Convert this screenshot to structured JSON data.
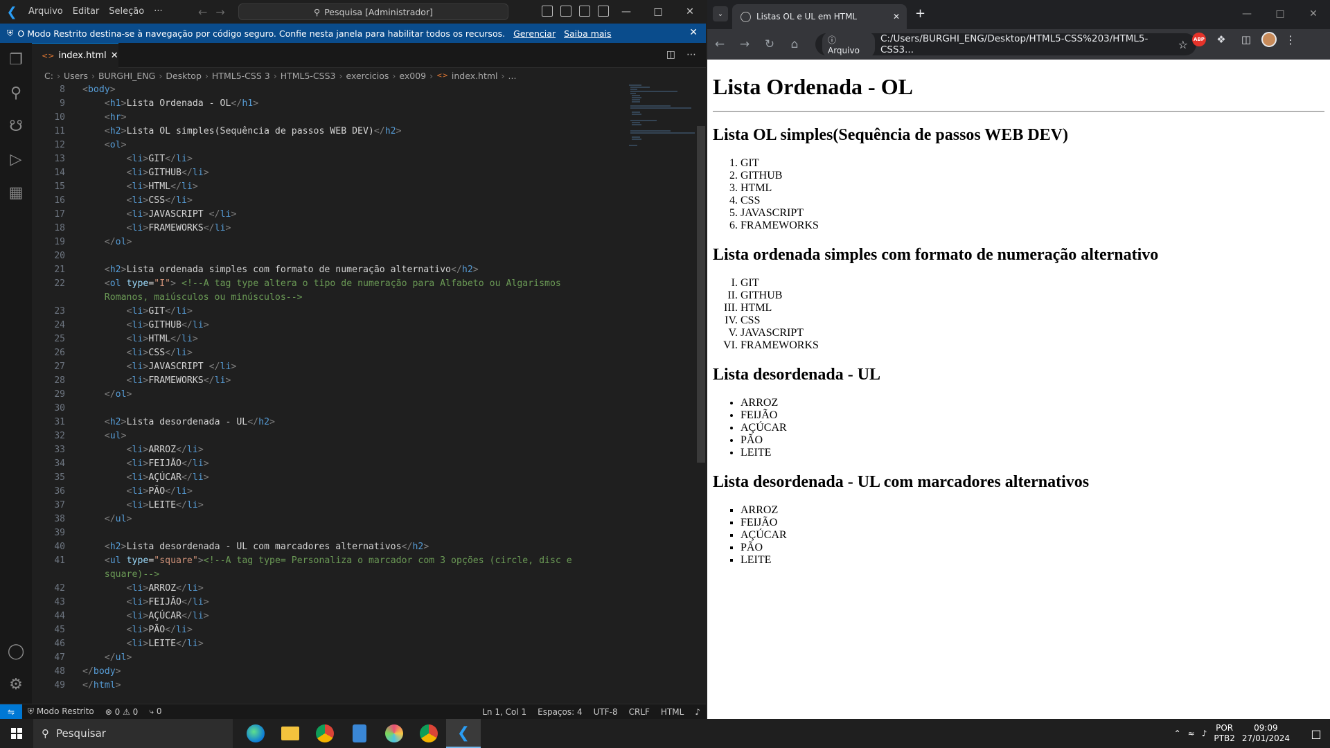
{
  "vscode": {
    "menu": [
      "Arquivo",
      "Editar",
      "Seleção",
      "···"
    ],
    "search_placeholder": "Pesquisa [Administrador]",
    "banner": {
      "text": "O Modo Restrito destina-se à navegação por código seguro. Confie nesta janela para habilitar todos os recursos.",
      "manage": "Gerenciar",
      "learn_more": "Saiba mais"
    },
    "tab": {
      "label": "index.html"
    },
    "breadcrumb": [
      "C:",
      "Users",
      "BURGHI_ENG",
      "Desktop",
      "HTML5-CSS 3",
      "HTML5-CSS3",
      "exercicios",
      "ex009",
      "index.html",
      "..."
    ],
    "line_numbers": [
      "8",
      "9",
      "10",
      "11",
      "12",
      "13",
      "14",
      "15",
      "16",
      "17",
      "18",
      "19",
      "20",
      "21",
      "22",
      "",
      "23",
      "24",
      "25",
      "26",
      "27",
      "28",
      "29",
      "30",
      "31",
      "32",
      "33",
      "34",
      "35",
      "36",
      "37",
      "38",
      "39",
      "40",
      "41",
      "",
      "42",
      "43",
      "44",
      "45",
      "46",
      "47",
      "48",
      "49"
    ],
    "status": {
      "restricted": "Modo Restrito",
      "errors": "0",
      "warnings": "0",
      "ports": "0",
      "position": "Ln 1, Col 1",
      "spaces": "Espaços: 4",
      "encoding": "UTF-8",
      "eol": "CRLF",
      "language": "HTML"
    }
  },
  "browser": {
    "tab_title": "Listas OL e UL em HTML",
    "site_chip": "Arquivo",
    "url": "C:/Users/BURGHI_ENG/Desktop/HTML5-CSS%203/HTML5-CSS3...",
    "extension_badge": "ABP",
    "page": {
      "h1": "Lista Ordenada - OL",
      "sections": [
        {
          "title": "Lista OL simples(Sequência de passos WEB DEV)",
          "items": [
            "GIT",
            "GITHUB",
            "HTML",
            "CSS",
            "JAVASCRIPT",
            "FRAMEWORKS"
          ]
        },
        {
          "title": "Lista ordenada simples com formato de numeração alternativo",
          "items": [
            "GIT",
            "GITHUB",
            "HTML",
            "CSS",
            "JAVASCRIPT",
            "FRAMEWORKS"
          ]
        },
        {
          "title": "Lista desordenada - UL",
          "items": [
            "ARROZ",
            "FEIJÃO",
            "AÇÚCAR",
            "PÃO",
            "LEITE"
          ]
        },
        {
          "title": "Lista desordenada - UL com marcadores alternativos",
          "items": [
            "ARROZ",
            "FEIJÃO",
            "AÇÚCAR",
            "PÃO",
            "LEITE"
          ]
        }
      ]
    }
  },
  "taskbar": {
    "search_placeholder": "Pesquisar",
    "lang": "POR",
    "lang_sub": "PTB2",
    "time": "09:09",
    "date": "27/01/2024"
  },
  "colors": {
    "banner": "#0a4c8c",
    "accent": "#0078d4",
    "tag": "#569cd6",
    "attr": "#9cdcfe",
    "string": "#ce9178",
    "comment": "#6a9955"
  }
}
